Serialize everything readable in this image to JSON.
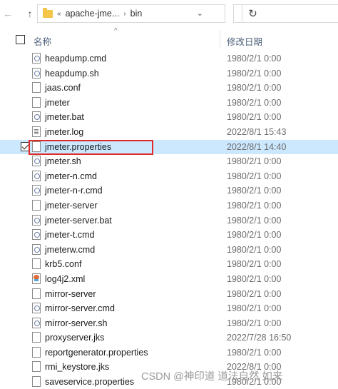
{
  "address": {
    "back": "←",
    "forward": "→",
    "up": "↑",
    "crumb_sep": "«",
    "crumb_1": "apache-jme...",
    "crumb_arrow": "›",
    "crumb_2": "bin",
    "dropdown": "⌄",
    "refresh": "↻"
  },
  "header": {
    "name_label": "名称",
    "date_label": "修改日期",
    "sort_arrow": "^"
  },
  "files": [
    {
      "name": "heapdump.cmd",
      "date": "1980/2/1 0:00",
      "icon": "cfg"
    },
    {
      "name": "heapdump.sh",
      "date": "1980/2/1 0:00",
      "icon": "cfg"
    },
    {
      "name": "jaas.conf",
      "date": "1980/2/1 0:00",
      "icon": "blank"
    },
    {
      "name": "jmeter",
      "date": "1980/2/1 0:00",
      "icon": "blank"
    },
    {
      "name": "jmeter.bat",
      "date": "1980/2/1 0:00",
      "icon": "cfg"
    },
    {
      "name": "jmeter.log",
      "date": "2022/8/1 15:43",
      "icon": "log"
    },
    {
      "name": "jmeter.properties",
      "date": "2022/8/1 14:40",
      "icon": "blank",
      "selected": true
    },
    {
      "name": "jmeter.sh",
      "date": "1980/2/1 0:00",
      "icon": "cfg"
    },
    {
      "name": "jmeter-n.cmd",
      "date": "1980/2/1 0:00",
      "icon": "cfg"
    },
    {
      "name": "jmeter-n-r.cmd",
      "date": "1980/2/1 0:00",
      "icon": "cfg"
    },
    {
      "name": "jmeter-server",
      "date": "1980/2/1 0:00",
      "icon": "blank"
    },
    {
      "name": "jmeter-server.bat",
      "date": "1980/2/1 0:00",
      "icon": "cfg"
    },
    {
      "name": "jmeter-t.cmd",
      "date": "1980/2/1 0:00",
      "icon": "cfg"
    },
    {
      "name": "jmeterw.cmd",
      "date": "1980/2/1 0:00",
      "icon": "cfg"
    },
    {
      "name": "krb5.conf",
      "date": "1980/2/1 0:00",
      "icon": "blank"
    },
    {
      "name": "log4j2.xml",
      "date": "1980/2/1 0:00",
      "icon": "xml"
    },
    {
      "name": "mirror-server",
      "date": "1980/2/1 0:00",
      "icon": "blank"
    },
    {
      "name": "mirror-server.cmd",
      "date": "1980/2/1 0:00",
      "icon": "cfg"
    },
    {
      "name": "mirror-server.sh",
      "date": "1980/2/1 0:00",
      "icon": "cfg"
    },
    {
      "name": "proxyserver.jks",
      "date": "2022/7/28 16:50",
      "icon": "blank"
    },
    {
      "name": "reportgenerator.properties",
      "date": "1980/2/1 0:00",
      "icon": "blank"
    },
    {
      "name": "rmi_keystore.jks",
      "date": "2022/8/1 0:00",
      "icon": "blank"
    },
    {
      "name": "saveservice.properties",
      "date": "1980/2/1 0:00",
      "icon": "blank"
    }
  ],
  "watermark": "CSDN @神印道 道法自然 如来",
  "colors": {
    "selection": "#cce8ff",
    "highlight_border": "#e02a2a",
    "folder": "#f3c548"
  }
}
